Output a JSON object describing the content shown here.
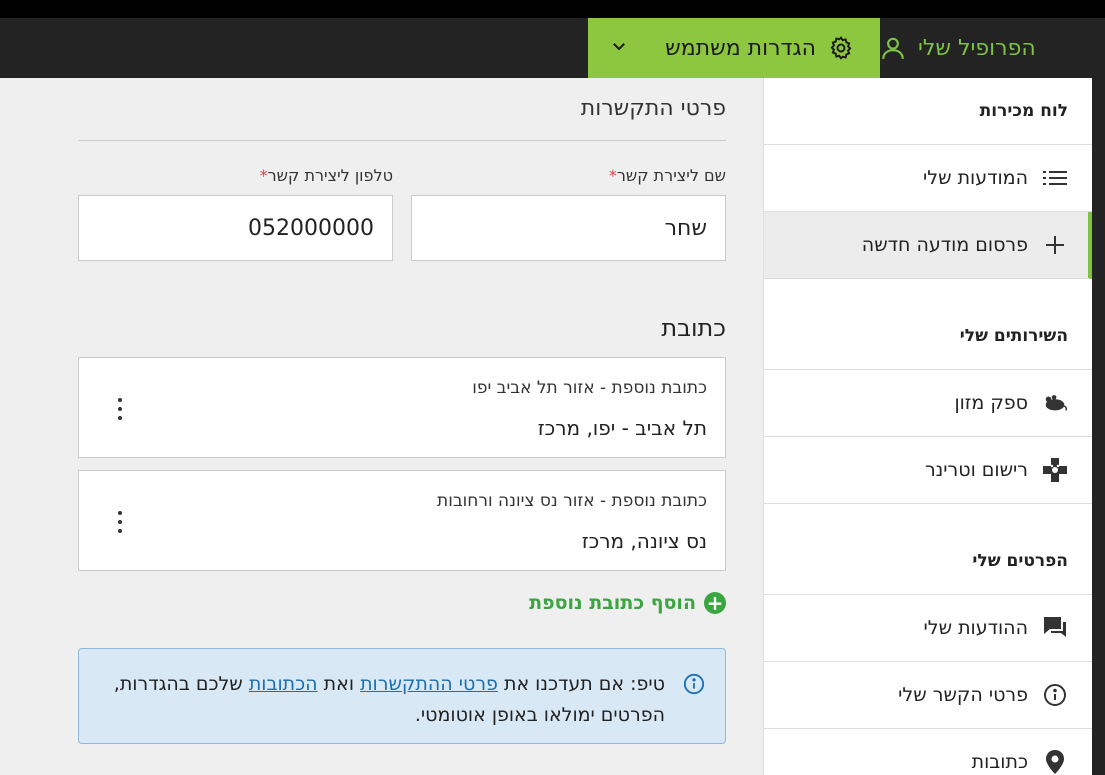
{
  "header": {
    "profile_label": "הפרופיל שלי",
    "settings_label": "הגדרות משתמש"
  },
  "sidebar": {
    "dashboard_label": "לוח מכירות",
    "items_top": [
      {
        "label": "המודעות שלי",
        "icon": "list-icon"
      },
      {
        "label": "פרסום מודעה חדשה",
        "icon": "plus-icon"
      }
    ],
    "services_label": "השירותים שלי",
    "services": [
      {
        "label": "ספק מזון",
        "icon": "pet-food-icon"
      },
      {
        "label": "רישום וטרינר",
        "icon": "vet-cross-icon"
      }
    ],
    "details_label": "הפרטים שלי",
    "details": [
      {
        "label": "ההודעות שלי",
        "icon": "messages-icon"
      },
      {
        "label": "פרטי הקשר שלי",
        "icon": "info-icon"
      },
      {
        "label": "כתובות",
        "icon": "location-pin-icon"
      }
    ]
  },
  "contact": {
    "title": "פרטי התקשרות",
    "name_label": "שם ליצירת קשר",
    "name_value": "שחר",
    "phone_label": "טלפון ליצירת קשר",
    "phone_value": "052000000",
    "required_mark": "*"
  },
  "address": {
    "title": "כתובת",
    "cards": [
      {
        "heading": "כתובת נוספת - אזור תל אביב יפו",
        "detail": "תל אביב - יפו, מרכז"
      },
      {
        "heading": "כתובת נוספת - אזור נס ציונה ורחובות",
        "detail": "נס ציונה, מרכז"
      }
    ],
    "add_label": "הוסף כתובת נוספת"
  },
  "tip": {
    "prefix": "טיפ: אם תעדכנו את",
    "link1": "פרטי ההתקשרות",
    "middle": "ואת",
    "link2": "הכתובות",
    "suffix": "שלכם בהגדרות, הפרטים ימולאו באופן אוטומטי."
  },
  "colors": {
    "accent_green": "#8dc63f",
    "profile_green": "#7dc242",
    "topbar": "#232323",
    "tip_bg": "#d9e8f5",
    "required_red": "#e04040"
  }
}
